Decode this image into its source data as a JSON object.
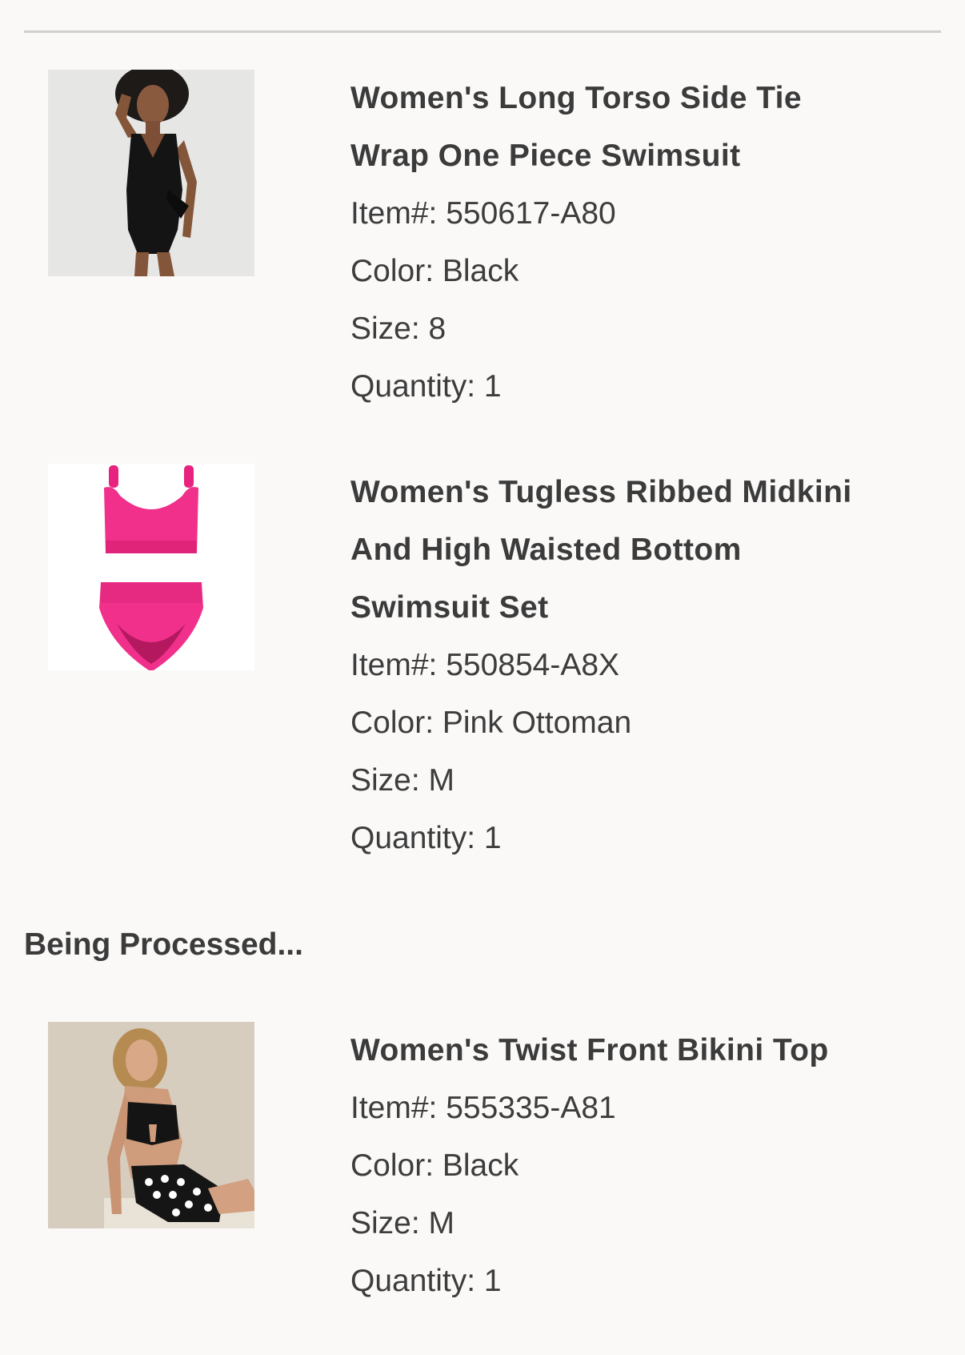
{
  "orders": {
    "shipped_items": [
      {
        "title_lines": [
          "Women's Long Torso Side Tie",
          "Wrap One Piece Swimsuit"
        ],
        "item_line": "Item#: 550617-A80",
        "color_line": "Color: Black",
        "size_line": "Size: 8",
        "quantity_line": "Quantity: 1",
        "image_icon": "swimsuit-photo-black-one-piece"
      },
      {
        "title_lines": [
          "Women's Tugless Ribbed Midkini",
          "And High Waisted Bottom",
          "Swimsuit Set"
        ],
        "item_line": "Item#: 550854-A8X",
        "color_line": "Color: Pink Ottoman",
        "size_line": "Size: M",
        "quantity_line": "Quantity: 1",
        "image_icon": "swimsuit-photo-pink-set"
      }
    ],
    "processing_heading": "Being Processed...",
    "processing_items": [
      {
        "title_lines": [
          "Women's Twist Front Bikini Top"
        ],
        "item_line": "Item#: 555335-A81",
        "color_line": "Color: Black",
        "size_line": "Size: M",
        "quantity_line": "Quantity: 1",
        "image_icon": "swimsuit-photo-bikini-top"
      }
    ]
  },
  "colors": {
    "background": "#faf9f8",
    "text": "#3b3b3b",
    "divider": "#cfcfcf",
    "pink_product": "#f0308a"
  }
}
